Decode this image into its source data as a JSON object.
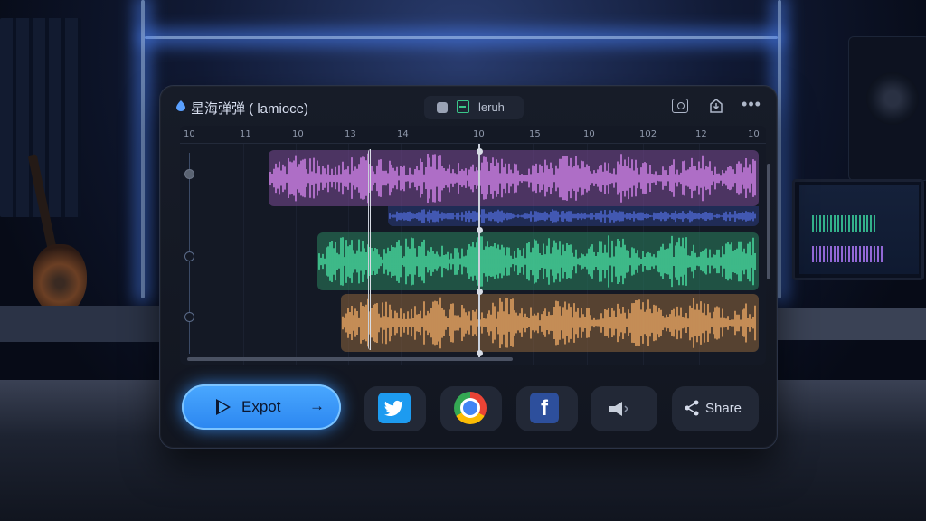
{
  "app": {
    "title": "星海弹弹 ( lamiocе)",
    "center_label": "lеruh",
    "icons": {
      "camera": "camera-icon",
      "export": "export-icon",
      "more": "more-icon"
    }
  },
  "timeline": {
    "ruler_labels": [
      "10",
      "11",
      "10",
      "13",
      "14",
      "10",
      "15",
      "10",
      "102",
      "12",
      "10"
    ],
    "tracks": [
      {
        "name": "purple",
        "color": "#c77ddf"
      },
      {
        "name": "blue",
        "color": "#4b63c9"
      },
      {
        "name": "green",
        "color": "#45d39a"
      },
      {
        "name": "orange",
        "color": "#e0a060"
      }
    ]
  },
  "actions": {
    "export_label": "Expot",
    "export_arrow": "→",
    "share_label": "Share",
    "targets": [
      "twitter-icon",
      "chrome-icon",
      "facebook-icon",
      "megaphone-icon",
      "share-icon"
    ]
  }
}
